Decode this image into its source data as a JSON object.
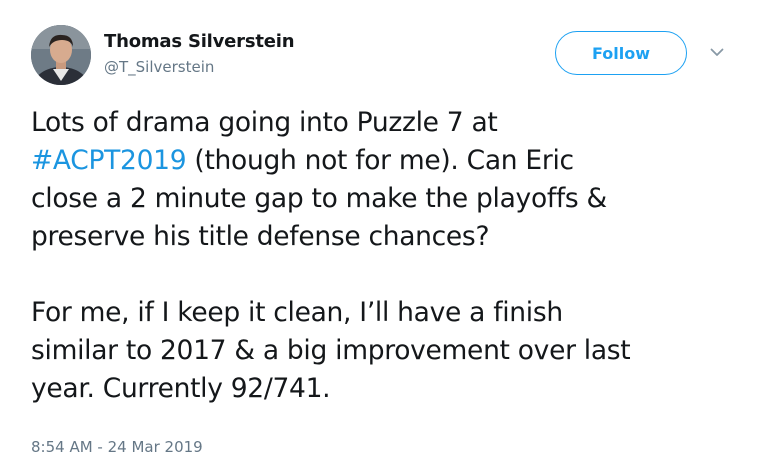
{
  "author": {
    "display_name": "Thomas Silverstein",
    "handle": "@T_Silverstein"
  },
  "actions": {
    "follow_label": "Follow",
    "more_icon": "chevron-down-icon"
  },
  "tweet": {
    "p1_line1": "Lots of drama going into Puzzle 7 at",
    "hashtag": "#ACPT2019",
    "p1_line2_rest": " (though not for me). Can Eric",
    "p1_line3": "close a 2 minute gap to make the playoffs &",
    "p1_line4": "preserve his title defense chances?",
    "p2_line1": "For me, if I keep it clean, I’ll have a finish",
    "p2_line2": "similar to 2017 & a big improvement over last",
    "p2_line3": "year. Currently 92/741."
  },
  "timestamp": "8:54 AM - 24 Mar 2019",
  "colors": {
    "accent": "#1da1f2",
    "hashtag": "#1b95e0",
    "secondary_text": "#657786",
    "primary_text": "#14171a"
  }
}
